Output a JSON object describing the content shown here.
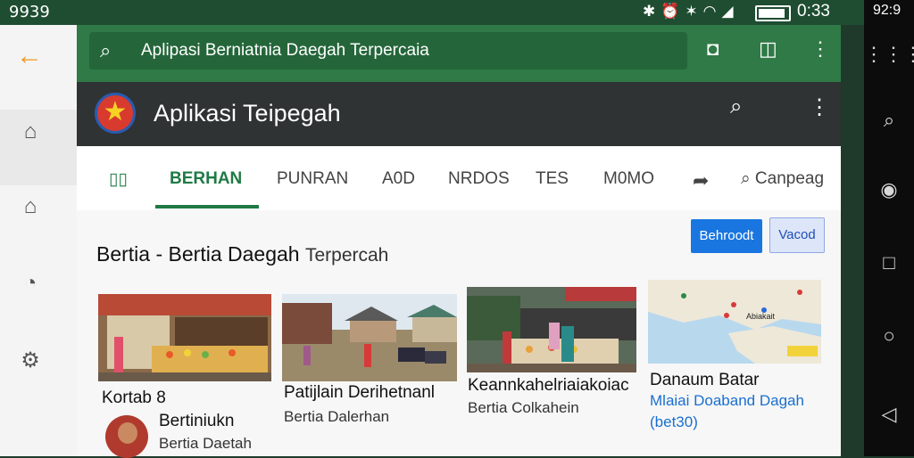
{
  "status_bar": {
    "time_left": "9939",
    "time_right": "0:33",
    "battery_level": 0.9
  },
  "right_panel": {
    "time": "92:9"
  },
  "search": {
    "query": "Aplipasi Berniatnia Daegah  Terpercaia"
  },
  "app_bar": {
    "title": "Aplikasi Teipegah"
  },
  "tabs": [
    {
      "label": "BERHAN"
    },
    {
      "label": "PUNRAN"
    },
    {
      "label": "A0D"
    },
    {
      "label": "NRDOS"
    },
    {
      "label": "TES"
    },
    {
      "label": "M0MO"
    },
    {
      "label": "Canpeag"
    }
  ],
  "section": {
    "title": "Bertia - Bertia Daegah",
    "subtitle": "Terpercah"
  },
  "buttons": {
    "primary": "Behroodt",
    "secondary": "Vacod"
  },
  "cards": [
    {
      "title": "Kortab",
      "extra": "8",
      "sub_title": "Bertiniukn",
      "sub_text": "Bertia Daetah"
    },
    {
      "title": "Patijlain Derihetnanl",
      "sub": "Bertia Dalerhan"
    },
    {
      "title": "Keannkahelriaiakoiac",
      "sub": "Bertia Colkahein"
    },
    {
      "title": "Danaum Batar",
      "sub": "Mlaiai Doaband Dagah",
      "extra": "(bet30)"
    }
  ],
  "map_label": "Abiakait",
  "colors": {
    "primary_green": "#2f7a46",
    "app_bar": "#2f3334",
    "active_tab": "#1f7a45",
    "button_blue": "#1976e0",
    "back_arrow": "#f09a22"
  }
}
